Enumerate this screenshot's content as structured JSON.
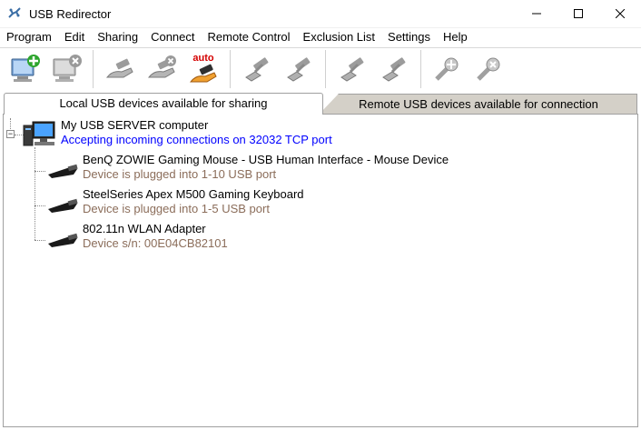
{
  "window": {
    "title": "USB Redirector",
    "minimize_icon": "minimize-icon",
    "maximize_icon": "maximize-icon",
    "close_icon": "close-icon"
  },
  "menu": {
    "items": [
      "Program",
      "Edit",
      "Sharing",
      "Connect",
      "Remote Control",
      "Exclusion List",
      "Settings",
      "Help"
    ]
  },
  "toolbar": {
    "auto_label": "auto",
    "buttons": [
      "add-computer-icon",
      "remove-computer-icon",
      "share-device-icon",
      "unshare-device-icon",
      "auto-share-icon",
      "connect-device-icon",
      "disconnect-device-icon",
      "remote-connect-icon",
      "remote-disconnect-icon",
      "add-exclusion-icon",
      "remove-exclusion-icon"
    ]
  },
  "tabs": {
    "local": "Local USB devices available for sharing",
    "remote": "Remote USB devices available for connection"
  },
  "tree": {
    "server": {
      "name": "My USB SERVER computer",
      "status": "Accepting incoming connections on 32032 TCP port"
    },
    "devices": [
      {
        "name": "BenQ ZOWIE Gaming Mouse - USB Human Interface - Mouse Device",
        "detail": "Device is plugged into 1-10 USB port"
      },
      {
        "name": "SteelSeries Apex M500 Gaming Keyboard",
        "detail": "Device is plugged into 1-5 USB port"
      },
      {
        "name": "802.11n WLAN Adapter",
        "detail": "Device s/n: 00E04CB82101"
      }
    ]
  },
  "colors": {
    "status_blue": "#0000ff",
    "detail_brown": "#8b6d5a",
    "tab_inactive_bg": "#d4d0c8"
  }
}
